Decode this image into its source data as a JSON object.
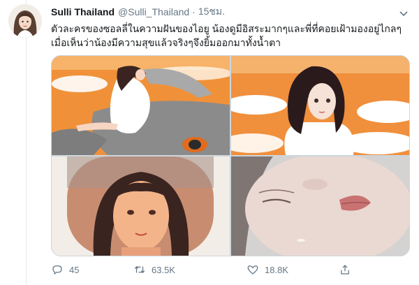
{
  "tweet": {
    "display_name": "Sulli Thailand",
    "handle": "@Sulli_Thailand",
    "separator": "·",
    "time": "15ชม.",
    "text_line1": "ตัวละครของซอลลี่ในความฝันของไอยู น้องดูมีอิสระมากๆและพี่ที่คอยเฝ้ามองอยู่ไกลๆ",
    "text_line2": "เมื่อเห็นว่าน้องมีความสุขแล้วจริงๆจึงยิ้มออกมาทั้งน้ำตา"
  },
  "actions": {
    "reply_count": "45",
    "retweet_count": "63.5K",
    "like_count": "18.8K"
  },
  "icons": {
    "reply": "reply-icon",
    "retweet": "retweet-icon",
    "like": "like-icon",
    "share": "share-icon",
    "more": "chevron-down-icon"
  },
  "colors": {
    "text": "#14171a",
    "muted": "#657786",
    "border": "#e6ecf0",
    "orange_sky": "#f0913a"
  }
}
